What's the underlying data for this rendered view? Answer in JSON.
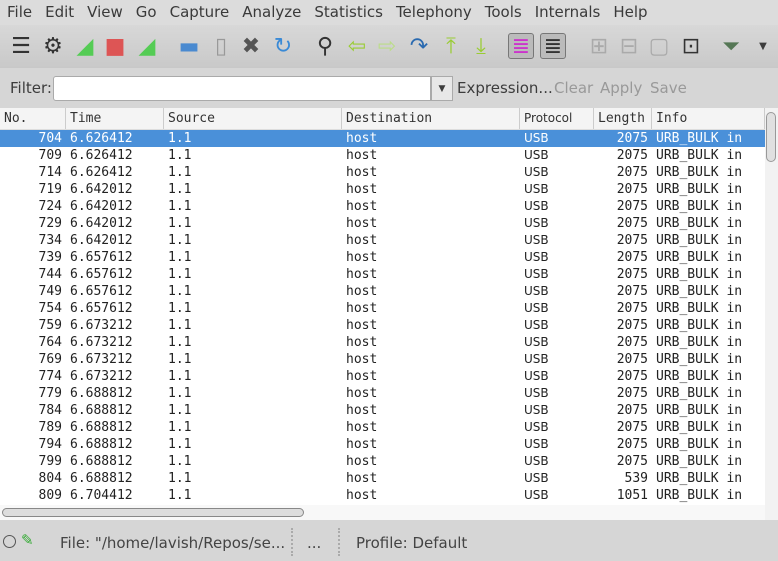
{
  "menu": [
    "File",
    "Edit",
    "View",
    "Go",
    "Capture",
    "Analyze",
    "Statistics",
    "Telephony",
    "Tools",
    "Internals",
    "Help"
  ],
  "toolbar": [
    "interfaces-icon",
    "options-icon",
    "start-capture-icon",
    "stop-capture-icon",
    "restart-capture-icon",
    "open-file-icon",
    "file-icon",
    "close-file-icon",
    "reload-icon",
    "find-icon",
    "back-icon",
    "forward-icon",
    "goto-icon",
    "first-packet-icon",
    "last-packet-icon",
    "colorize-icon",
    "autoscroll-icon",
    "zoom-in-icon",
    "zoom-out-icon",
    "normal-size-icon",
    "resize-columns-icon",
    "capture-filters-icon"
  ],
  "filter": {
    "label": "Filter:",
    "value": "",
    "expression": "Expression...",
    "clear": "Clear",
    "apply": "Apply",
    "save": "Save"
  },
  "columns": [
    "No.",
    "Time",
    "Source",
    "Destination",
    "Protocol",
    "Length",
    "Info"
  ],
  "rows": [
    [
      "704",
      "6.626412",
      "1.1",
      "host",
      "USB",
      "2075",
      "URB_BULK in"
    ],
    [
      "709",
      "6.626412",
      "1.1",
      "host",
      "USB",
      "2075",
      "URB_BULK in"
    ],
    [
      "714",
      "6.626412",
      "1.1",
      "host",
      "USB",
      "2075",
      "URB_BULK in"
    ],
    [
      "719",
      "6.642012",
      "1.1",
      "host",
      "USB",
      "2075",
      "URB_BULK in"
    ],
    [
      "724",
      "6.642012",
      "1.1",
      "host",
      "USB",
      "2075",
      "URB_BULK in"
    ],
    [
      "729",
      "6.642012",
      "1.1",
      "host",
      "USB",
      "2075",
      "URB_BULK in"
    ],
    [
      "734",
      "6.642012",
      "1.1",
      "host",
      "USB",
      "2075",
      "URB_BULK in"
    ],
    [
      "739",
      "6.657612",
      "1.1",
      "host",
      "USB",
      "2075",
      "URB_BULK in"
    ],
    [
      "744",
      "6.657612",
      "1.1",
      "host",
      "USB",
      "2075",
      "URB_BULK in"
    ],
    [
      "749",
      "6.657612",
      "1.1",
      "host",
      "USB",
      "2075",
      "URB_BULK in"
    ],
    [
      "754",
      "6.657612",
      "1.1",
      "host",
      "USB",
      "2075",
      "URB_BULK in"
    ],
    [
      "759",
      "6.673212",
      "1.1",
      "host",
      "USB",
      "2075",
      "URB_BULK in"
    ],
    [
      "764",
      "6.673212",
      "1.1",
      "host",
      "USB",
      "2075",
      "URB_BULK in"
    ],
    [
      "769",
      "6.673212",
      "1.1",
      "host",
      "USB",
      "2075",
      "URB_BULK in"
    ],
    [
      "774",
      "6.673212",
      "1.1",
      "host",
      "USB",
      "2075",
      "URB_BULK in"
    ],
    [
      "779",
      "6.688812",
      "1.1",
      "host",
      "USB",
      "2075",
      "URB_BULK in"
    ],
    [
      "784",
      "6.688812",
      "1.1",
      "host",
      "USB",
      "2075",
      "URB_BULK in"
    ],
    [
      "789",
      "6.688812",
      "1.1",
      "host",
      "USB",
      "2075",
      "URB_BULK in"
    ],
    [
      "794",
      "6.688812",
      "1.1",
      "host",
      "USB",
      "2075",
      "URB_BULK in"
    ],
    [
      "799",
      "6.688812",
      "1.1",
      "host",
      "USB",
      "2075",
      "URB_BULK in"
    ],
    [
      "804",
      "6.688812",
      "1.1",
      "host",
      "USB",
      "539",
      "URB_BULK in"
    ],
    [
      "809",
      "6.704412",
      "1.1",
      "host",
      "USB",
      "1051",
      "URB_BULK in"
    ]
  ],
  "selected_row": 0,
  "status": {
    "file": "File: \"/home/lavish/Repos/se...",
    "middle": "...",
    "profile": "Profile: Default"
  },
  "colors": {
    "selection": "#4a90d9"
  }
}
